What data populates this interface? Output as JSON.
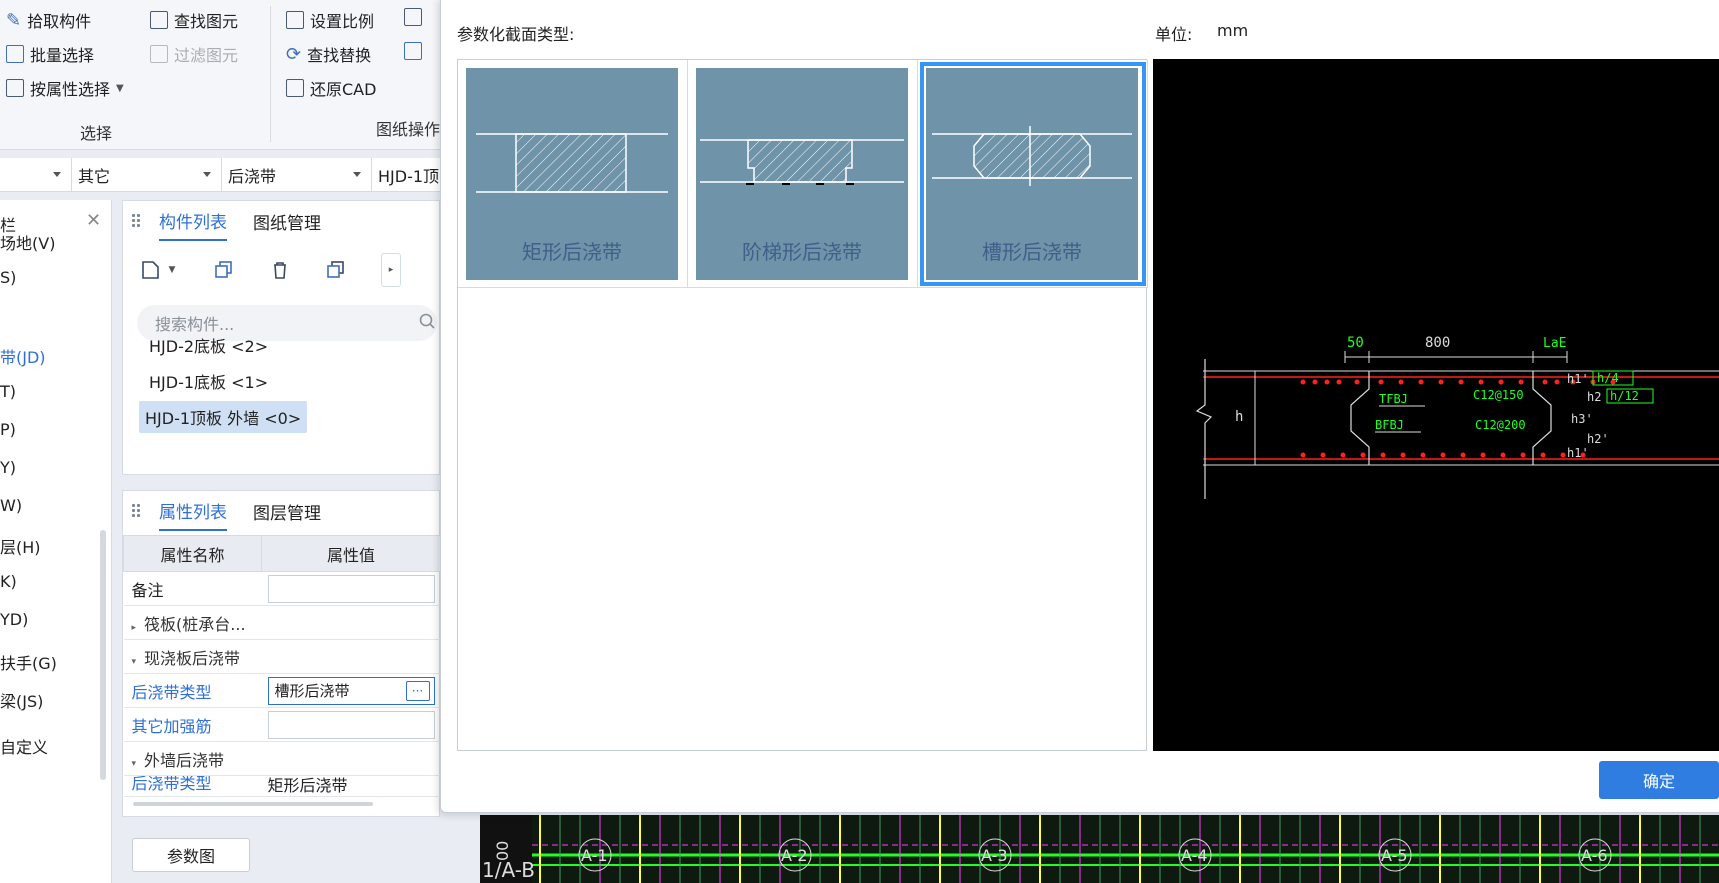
{
  "ribbon": {
    "pick_component": "拾取构件",
    "batch_select": "批量选择",
    "select_by_attr": "按属性选择",
    "find_element": "查找图元",
    "filter_element": "过滤图元",
    "set_scale": "设置比例",
    "find_replace": "查找替换",
    "restore_cad": "还原CAD",
    "group_select": "选择",
    "group_drawing": "图纸操作"
  },
  "filterbar": {
    "dd2": "其它",
    "dd3": "后浇带",
    "dd4": "HJD-1顶"
  },
  "leftnav": {
    "title": "栏",
    "items": [
      "场地(V)",
      "S)",
      "带(JD)",
      "T)",
      "P)",
      "Y)",
      "W)",
      "层(H)",
      "K)",
      "YD)",
      "扶手(G)",
      "梁(JS)",
      "自定义"
    ]
  },
  "component_panel": {
    "tab_list": "构件列表",
    "tab_drawing": "图纸管理",
    "search_placeholder": "搜索构件...",
    "items": [
      "HJD-2底板 <2>",
      "HJD-1底板 <1>",
      "HJD-1顶板 外墙 <0>"
    ]
  },
  "props_panel": {
    "tab_props": "属性列表",
    "tab_layers": "图层管理",
    "col_name": "属性名称",
    "col_value": "属性值",
    "row_note": "备注",
    "group_raft": "筏板(桩承台...",
    "group_slab": "现浇板后浇带",
    "row_type": "后浇带类型",
    "row_type_value": "槽形后浇带",
    "row_rebar": "其它加强筋",
    "group_wall": "外墙后浇带",
    "row_wall_type": "后浇带类型",
    "row_wall_type_value": "矩形后浇带",
    "more": "···"
  },
  "param_button": "参数图",
  "dialog": {
    "section_label": "参数化截面类型:",
    "unit_label": "单位:",
    "unit_value": "mm",
    "types": [
      "矩形后浇带",
      "阶梯形后浇带",
      "槽形后浇带"
    ],
    "selected_index": 2,
    "ok": "确定",
    "preview_labels": {
      "d50": "50",
      "d800": "800",
      "lae": "LaE",
      "h": "h",
      "h1a": "h1'",
      "h4": "h/4",
      "h2": "h2",
      "h12": "h/12",
      "tfbj": "TFBJ",
      "bfbj": "BFBJ",
      "c150": "C12@150",
      "c200": "C12@200",
      "h3": "h3'",
      "h2b": "h2'",
      "h1b": "h1'"
    }
  },
  "cad_strip": {
    "axis_label": "1/A-B",
    "left_num": "00",
    "axes": [
      "A-1",
      "A-2",
      "A-3",
      "A-4",
      "A-5",
      "A-6"
    ]
  },
  "colors": {
    "accent": "#2f6fd6",
    "thumb": "#6f93a8",
    "selection": "#3795f5",
    "cad_red": "#ff2020",
    "cad_green": "#20ff20"
  }
}
